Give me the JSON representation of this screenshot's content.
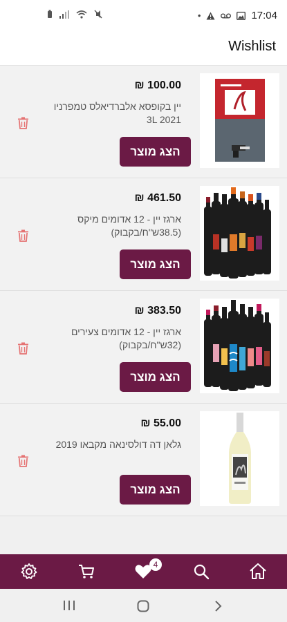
{
  "status_bar": {
    "time": "17:04",
    "left_icons": [
      "battery-icon",
      "signal-icon",
      "wifi-icon",
      "mute-icon"
    ],
    "right_icons": [
      "dot-icon",
      "alert-icon",
      "voicemail-icon",
      "image-icon"
    ]
  },
  "header": {
    "title": "Wishlist"
  },
  "colors": {
    "accent": "#6b1a45",
    "trash": "#e57373"
  },
  "wishlist": [
    {
      "price": "100.00 ₪",
      "name": "יין בקופסא אלברדיאלס טמפרניו 3L 2021",
      "button": "הצג מוצר",
      "image": "wine-box-image"
    },
    {
      "price": "461.50 ₪",
      "name": "ארגז יין - 12 אדומים מיקס (38.5ש\"ח/בקבוק)",
      "button": "הצג מוצר",
      "image": "red-wine-mix-image"
    },
    {
      "price": "383.50 ₪",
      "name": "ארגז יין - 12 אדומים צעירים (32ש\"ח/בקבוק)",
      "button": "הצג מוצר",
      "image": "young-red-wine-image"
    },
    {
      "price": "55.00 ₪",
      "name": "גלאן דה דולסינאה מקבאו 2019",
      "button": "הצג מוצר",
      "image": "white-wine-bottle-image"
    }
  ],
  "bottom_nav": {
    "items": [
      "settings-icon",
      "cart-icon",
      "wishlist-heart-icon",
      "search-icon",
      "home-icon"
    ],
    "wishlist_count": "4"
  },
  "system_nav": [
    "recents-icon",
    "home-circle-icon",
    "back-icon"
  ]
}
